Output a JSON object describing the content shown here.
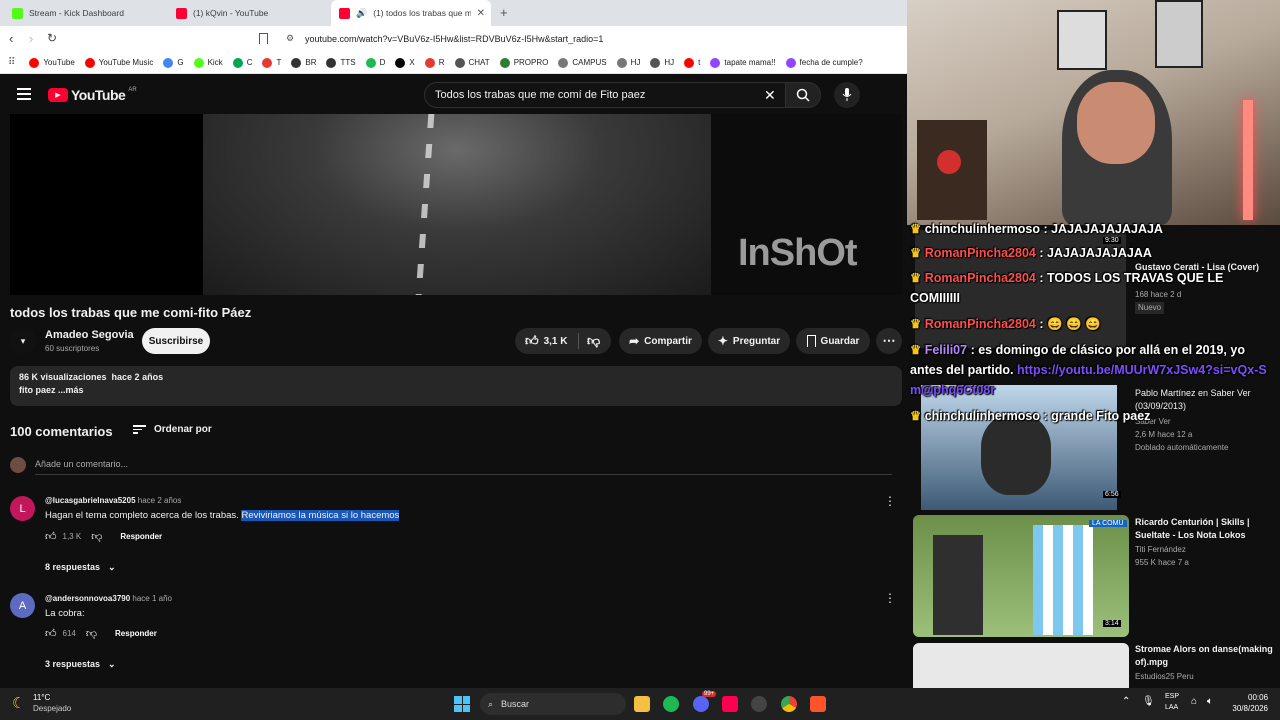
{
  "browser": {
    "tabs": [
      {
        "title": "Stream - Kick Dashboard",
        "color": "#53fc18",
        "active": false
      },
      {
        "title": "(1) kQvin - YouTube",
        "color": "#ff0033",
        "active": false
      },
      {
        "title": "(1) todos los trabas que me c",
        "color": "#ff0033",
        "active": true
      }
    ],
    "url": "youtube.com/watch?v=VBuV6z-I5Hw&list=RDVBuV6z-I5Hw&start_radio=1",
    "bookmarks": [
      {
        "label": "YouTube",
        "color": "#ff0000"
      },
      {
        "label": "YouTube Music",
        "color": "#ff0000"
      },
      {
        "label": "G",
        "color": "#4285f4"
      },
      {
        "label": "Kick",
        "color": "#53fc18"
      },
      {
        "label": "C",
        "color": "#00a651"
      },
      {
        "label": "T",
        "color": "#e53935"
      },
      {
        "label": "BR",
        "color": "#333333"
      },
      {
        "label": "TTS",
        "color": "#333333"
      },
      {
        "label": "D",
        "color": "#1db954"
      },
      {
        "label": "X",
        "color": "#000000"
      },
      {
        "label": "R",
        "color": "#e53935"
      },
      {
        "label": "CHAT",
        "color": "#555555"
      },
      {
        "label": "PROPRO",
        "color": "#2e7d32"
      },
      {
        "label": "CAMPUS",
        "color": "#777777"
      },
      {
        "label": "HJ",
        "color": "#777777"
      },
      {
        "label": "HJ",
        "color": "#555555"
      },
      {
        "label": "t",
        "color": "#ff0000"
      },
      {
        "label": "tapate mama!!",
        "color": "#9146ff"
      },
      {
        "label": "fecha de cumple?",
        "color": "#9146ff"
      }
    ]
  },
  "youtube": {
    "logo": "YouTube",
    "country": "AR",
    "search_value": "Todos los trabas que me comí de Fito paez",
    "video_watermark": "InShOt",
    "video_title": "todos los trabas que me comi-fito Páez",
    "channel": {
      "name": "Amadeo Segovia",
      "subs": "60 suscriptores",
      "subscribe": "Suscribirse"
    },
    "actions": {
      "likes": "3,1 K",
      "share": "Compartir",
      "ask": "Preguntar",
      "save": "Guardar"
    },
    "description": {
      "stats": "86 K visualizaciones  hace 2 años",
      "text": "fito paez ...más"
    },
    "comments_header": {
      "count": "100 comentarios",
      "sort": "Ordenar por",
      "add_placeholder": "Añade un comentario..."
    },
    "comments": [
      {
        "avatar_letter": "L",
        "avatar_color": "#c2185b",
        "user": "@lucasgabrielnava5205",
        "time": "hace 2 años",
        "text_plain": "Hagan el tema completo acerca de los trabas.",
        "text_highlight": "Reviviriamos la música si lo hacemos",
        "likes": "1,3 K",
        "reply": "Responder",
        "replies": "8 respuestas"
      },
      {
        "avatar_letter": "A",
        "avatar_color": "#5c6bc0",
        "user": "@andersonnovoa3790",
        "time": "hace 1 año",
        "text_plain": "La cobra:",
        "text_highlight": "",
        "likes": "614",
        "reply": "Responder",
        "replies": "3 respuestas"
      }
    ]
  },
  "stream": {
    "chat": [
      {
        "user": "chinchulinhermoso",
        "msg": "JAJAJAJAJAJAJA",
        "badge": true
      },
      {
        "user": "RomanPincha2804",
        "msg": "JAJAJAJAJAJAA",
        "badge": false
      },
      {
        "user": "RomanPincha2804",
        "msg": "TODOS LOS TRAVAS QUE LE COMIIIIII",
        "badge": false
      },
      {
        "user": "RomanPincha2804",
        "msg": "",
        "badge": false
      },
      {
        "user": "Felili07",
        "msg": "es domingo de clásico por allá en el 2019, yo antes del partido.",
        "badge": true
      },
      {
        "user": "",
        "msg": "https://youtu.be/MUUrW7xJSw4?si=vQx-Sm@phq6Ct08r",
        "badge": false
      },
      {
        "user": "chinchulinhermoso",
        "msg": "grande Fito paez",
        "badge": true
      }
    ],
    "recs": [
      {
        "duration": "9:30",
        "title": "Gustavo Cerati - Lisa (Cover)",
        "channel": "",
        "meta": "168  hace 2 d",
        "badge": "Nuevo"
      },
      {
        "duration": "6:56",
        "title": "Pablo Martínez en Saber Ver (03/09/2013)",
        "channel": "Saber Ver",
        "meta": "2,6 M  hace 12 a",
        "badge": "Doblado automáticamente"
      },
      {
        "duration": "3:14",
        "title": "Ricardo Centurión | Skills | Sueltate - Los Nota Lokos",
        "channel": "Titi Fernández",
        "meta": "955 K  hace 7 a",
        "badge": ""
      },
      {
        "duration": "",
        "title": "Stromae  Alors on danse(making of).mpg",
        "channel": "Estudios25 Peru",
        "meta": "",
        "badge": ""
      }
    ],
    "thumb_label": "LA COMU"
  },
  "taskbar": {
    "weather_temp": "11°C",
    "weather_desc": "Despejado",
    "search": "Buscar",
    "lang": "ESP",
    "lang2": "LAA",
    "time": "00:06",
    "date": "30/8/2026",
    "discord_badge": "99+"
  }
}
